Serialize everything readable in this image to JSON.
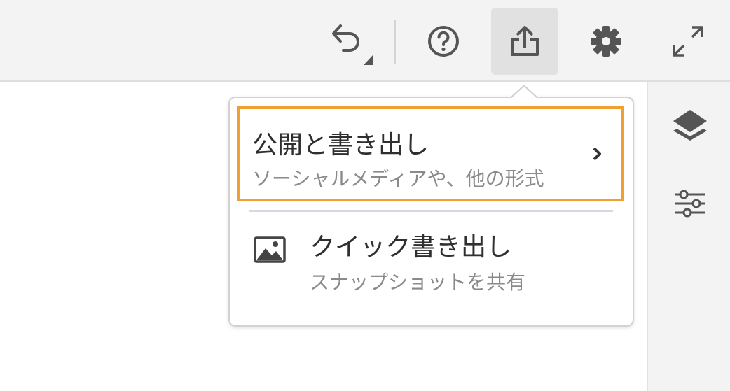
{
  "toolbar": {
    "undo_icon": "undo-icon",
    "help_icon": "help-circle-icon",
    "share_icon": "share-export-icon",
    "settings_icon": "gear-icon",
    "fullscreen_icon": "expand-icon"
  },
  "sidebar": {
    "layers_icon": "layers-icon",
    "adjust_icon": "sliders-icon"
  },
  "share_menu": {
    "items": [
      {
        "title": "公開と書き出し",
        "subtitle": "ソーシャルメディアや、他の形式",
        "icon": "chevron-right-icon"
      },
      {
        "title": "クイック書き出し",
        "subtitle": "スナップショットを共有",
        "icon": "image-icon"
      }
    ]
  },
  "colors": {
    "highlight": "#f0a030",
    "toolbar_bg": "#f3f3f3",
    "icon": "#444444"
  }
}
